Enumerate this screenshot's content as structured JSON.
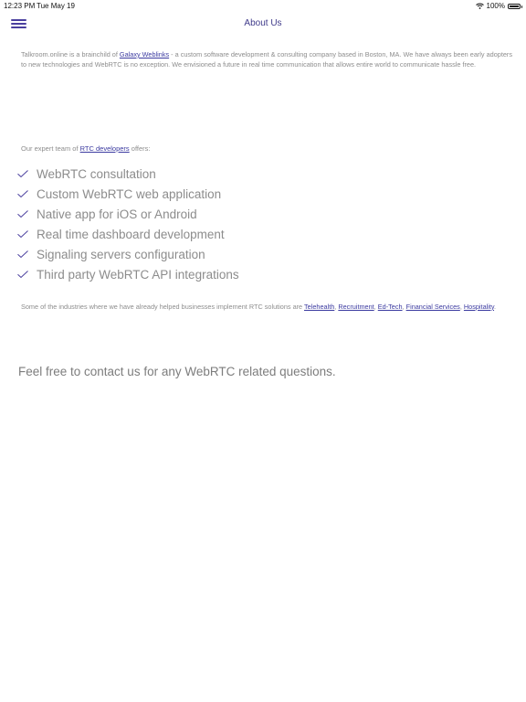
{
  "status": {
    "time": "12:23 PM",
    "date": "Tue May 19",
    "battery": "100%"
  },
  "nav": {
    "title": "About Us"
  },
  "intro": {
    "before": "Talkroom.online is a brainchild of ",
    "link": "Galaxy Weblinks",
    "after": " - a custom software development & consulting company based in Boston, MA. We have always been early adopters to new technologies and WebRTC is no exception. We envisioned a future in real time communication that allows entire world to communicate hassle free."
  },
  "team": {
    "before": "Our expert team of ",
    "link": "RTC developers",
    "after": " offers:"
  },
  "services": [
    "WebRTC consultation",
    "Custom WebRTC web application",
    "Native app for iOS or Android",
    "Real time dashboard development",
    "Signaling servers configuration",
    "Third party WebRTC API integrations"
  ],
  "industries": {
    "before": "Some of the industries where we have already helped businesses implement RTC solutions are ",
    "links": [
      "Telehealth",
      "Recruitment",
      "Ed-Tech",
      "Financial Services",
      "Hospitality"
    ],
    "separator": ", ",
    "end": "."
  },
  "contact": "Feel free to contact us for any WebRTC related questions.",
  "colors": {
    "accent": "#4a3f9e",
    "link": "#3b3aa0",
    "text": "#8d8d8d"
  }
}
